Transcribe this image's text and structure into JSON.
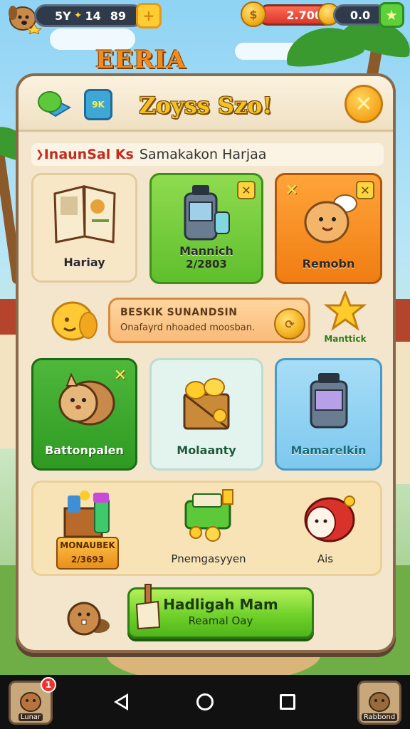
{
  "hud": {
    "level_text": "5Y",
    "xp_text": "14",
    "score": "89",
    "add_btn": "+",
    "coins_currency": "$",
    "coins_value": "2.700",
    "gems_value": "0.0",
    "star_icon": "star-icon"
  },
  "logo": {
    "text": "EERIA"
  },
  "panel": {
    "icon2_text": "9K",
    "title": "Zoyss Szo!",
    "close": "✕",
    "subtitle_red": "InaunSal Ks",
    "subtitle_rest": "Samakakon Harjaa"
  },
  "cards_top": [
    {
      "label": "Hariay",
      "sub": ""
    },
    {
      "label": "Mannich",
      "sub": "2/2803"
    },
    {
      "label": "Remobn",
      "sub": ""
    }
  ],
  "banner": {
    "line1": "BESKIK SUNANDSIN",
    "line2": "Onafayrd nhoaded moosban."
  },
  "side_right_label": "Manttick",
  "cards_mid": [
    {
      "label": "Battonpalen"
    },
    {
      "label": "Molaanty"
    },
    {
      "label": "Mamarelkin"
    }
  ],
  "shelf": {
    "bundle_line1": "MONAUBEK",
    "bundle_line2": "2/3693",
    "item2_label": "Pnemgasyyen",
    "item3_label": "Ais"
  },
  "cta": {
    "title": "Hadligah Mam",
    "sub": "Reamal Oay"
  },
  "nav": {
    "left_app_label": "Lunar",
    "left_badge": "1",
    "right_app_label": "Rabbond"
  },
  "colors": {
    "accent_gold": "#f4c21e",
    "panel_bg": "#f3e6cc",
    "cta_green": "#6fd12a",
    "subtitle_red": "#c42b1e"
  }
}
